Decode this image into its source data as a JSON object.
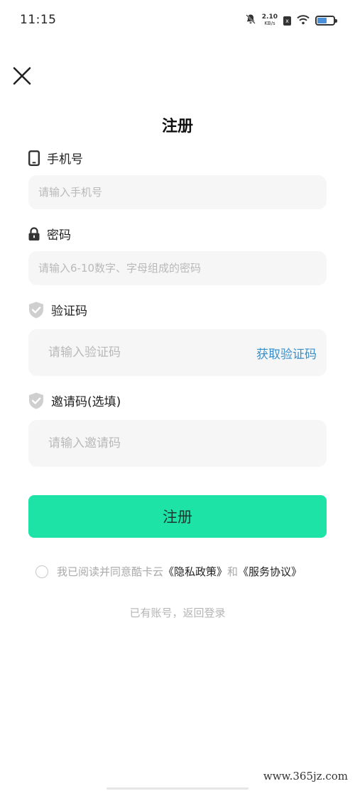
{
  "status_bar": {
    "time": "11:15",
    "net_speed_value": "2.10",
    "net_speed_unit": "KB/s",
    "sim_label": "x",
    "battery_level": 0.6,
    "battery_color": "#4a90d9"
  },
  "title": "注册",
  "phone": {
    "label": "手机号",
    "icon": "phone-icon",
    "placeholder": "请输入手机号",
    "value": ""
  },
  "password": {
    "label": "密码",
    "icon": "lock-icon",
    "placeholder": "请输入6-10数字、字母组成的密码",
    "value": ""
  },
  "verify": {
    "label": "验证码",
    "icon": "shield-check-icon",
    "placeholder": "请输入验证码",
    "value": "",
    "get_code_label": "获取验证码"
  },
  "invite": {
    "label": "邀请码(选填)",
    "icon": "shield-check-icon",
    "placeholder": "请输入邀请码",
    "value": ""
  },
  "submit_label": "注册",
  "agreement": {
    "prefix": "我已阅读并同意酷卡云",
    "privacy_link": "《隐私政策》",
    "conjunction": "和",
    "service_link": "《服务协议》",
    "checked": false
  },
  "login_link": "已有账号，返回登录",
  "watermark": "www.365jz.com",
  "colors": {
    "accent": "#1ee3a6",
    "link_blue": "#3a8fc9",
    "input_bg": "#f6f6f6"
  }
}
